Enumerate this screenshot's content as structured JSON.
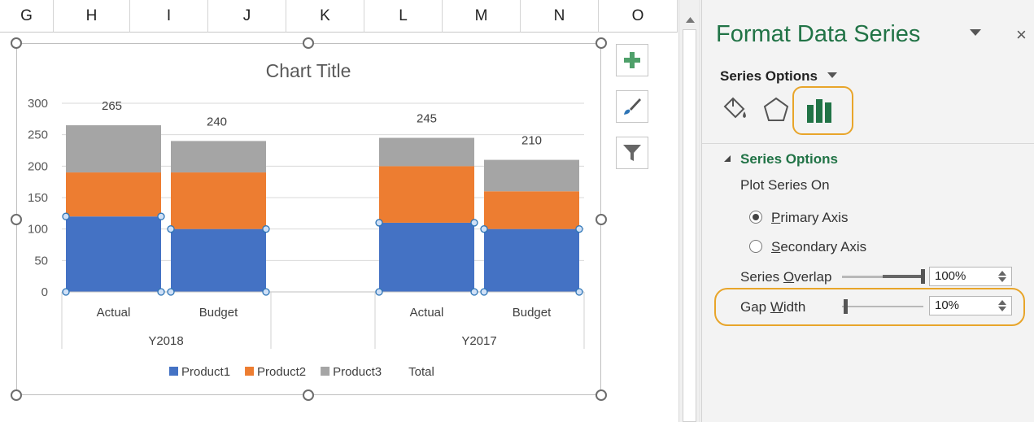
{
  "columns": [
    "G",
    "H",
    "I",
    "J",
    "K",
    "L",
    "M",
    "N",
    "O"
  ],
  "chart": {
    "title": "Chart Title",
    "yticks": [
      "300",
      "250",
      "200",
      "150",
      "100",
      "50",
      "0"
    ],
    "side_buttons": [
      "plus-icon",
      "paintbrush-icon",
      "filter-icon"
    ]
  },
  "chart_data": {
    "type": "bar",
    "stacked": true,
    "title": "Chart Title",
    "categories": [
      "Actual",
      "Budget",
      "",
      "Actual",
      "Budget"
    ],
    "groups": [
      "Y2018",
      "Y2017"
    ],
    "ylim": [
      0,
      300
    ],
    "yticks": [
      0,
      50,
      100,
      150,
      200,
      250,
      300
    ],
    "grid": true,
    "legend_position": "bottom",
    "series": [
      {
        "name": "Product1",
        "color": "#4472c4",
        "values": [
          120,
          100,
          null,
          110,
          100
        ]
      },
      {
        "name": "Product2",
        "color": "#ed7d31",
        "values": [
          70,
          90,
          null,
          90,
          60
        ]
      },
      {
        "name": "Product3",
        "color": "#a5a5a5",
        "values": [
          75,
          50,
          null,
          45,
          50
        ]
      },
      {
        "name": "Total",
        "values": [
          265,
          240,
          null,
          245,
          210
        ]
      }
    ],
    "total_labels": [
      "265",
      "240",
      "",
      "245",
      "210"
    ]
  },
  "pane": {
    "title": "Format Data Series",
    "close": "×",
    "series_options_label": "Series Options",
    "section_title": "Series Options",
    "plot_series_on": "Plot Series On",
    "primary_axis_prefix": "",
    "primary_axis": {
      "hot": "P",
      "rest": "rimary Axis"
    },
    "secondary_axis": {
      "hot": "S",
      "rest": "econdary Axis"
    },
    "series_overlap": {
      "pre": "Series ",
      "hot": "O",
      "rest": "verlap",
      "value": "100%",
      "level": 1.0
    },
    "gap_width": {
      "pre": "Gap ",
      "hot": "W",
      "rest": "idth",
      "value": "10%",
      "level": 0.02
    }
  },
  "colors": {
    "accent_green": "#217346",
    "highlight_orange": "#e8a52a"
  }
}
